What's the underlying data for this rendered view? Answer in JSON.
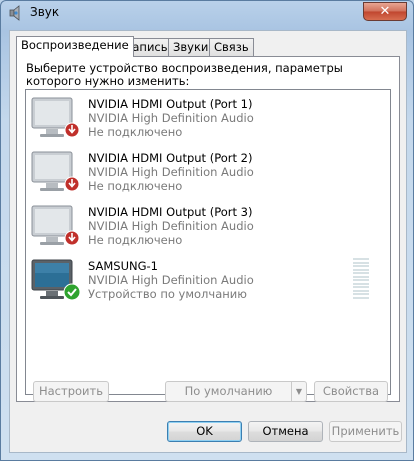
{
  "window": {
    "title": "Звук",
    "close_label": "✕"
  },
  "tabs": [
    {
      "label": "Воспроизведение",
      "active": true
    },
    {
      "label": "Запись",
      "active": false
    },
    {
      "label": "Звуки",
      "active": false
    },
    {
      "label": "Связь",
      "active": false
    }
  ],
  "instructions": "Выберите устройство воспроизведения, параметры которого нужно изменить:",
  "devices": [
    {
      "name": "NVIDIA HDMI Output (Port 1)",
      "driver": "NVIDIA High Definition Audio",
      "status": "Не подключено",
      "state": "disconnected"
    },
    {
      "name": "NVIDIA HDMI Output (Port 2)",
      "driver": "NVIDIA High Definition Audio",
      "status": "Не подключено",
      "state": "disconnected"
    },
    {
      "name": "NVIDIA HDMI Output (Port 3)",
      "driver": "NVIDIA High Definition Audio",
      "status": "Не подключено",
      "state": "disconnected"
    },
    {
      "name": "SAMSUNG-1",
      "driver": "NVIDIA High Definition Audio",
      "status": "Устройство по умолчанию",
      "state": "default"
    }
  ],
  "buttons": {
    "configure": "Настроить",
    "set_default": "По умолчанию",
    "properties": "Свойства",
    "ok": "OK",
    "cancel": "Отмена",
    "apply": "Применить"
  },
  "colors": {
    "disconnected_badge": "#c0302b",
    "default_badge": "#2fa32f"
  }
}
